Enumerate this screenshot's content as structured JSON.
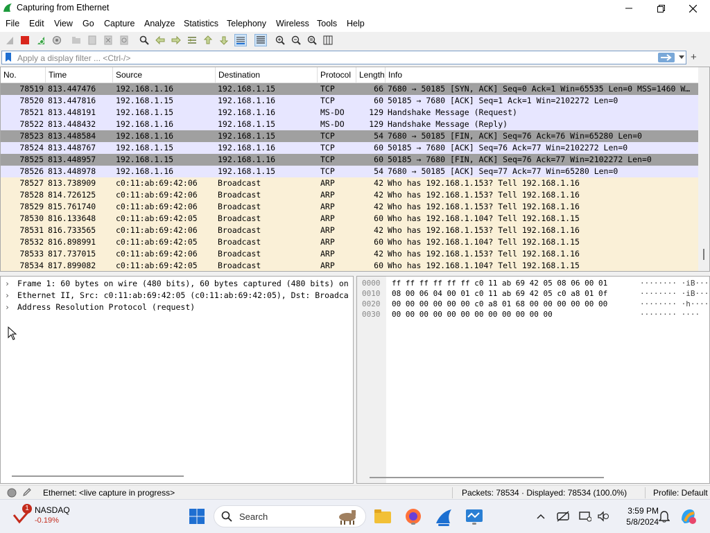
{
  "window": {
    "title": "Capturing from Ethernet"
  },
  "menu": [
    "File",
    "Edit",
    "View",
    "Go",
    "Capture",
    "Analyze",
    "Statistics",
    "Telephony",
    "Wireless",
    "Tools",
    "Help"
  ],
  "filter": {
    "placeholder": "Apply a display filter ... <Ctrl-/>",
    "value": ""
  },
  "packet_list": {
    "columns": [
      "No.",
      "Time",
      "Source",
      "Destination",
      "Protocol",
      "Length",
      "Info"
    ],
    "rows": [
      {
        "no": "78519",
        "time": "813.447476",
        "src": "192.168.1.16",
        "dst": "192.168.1.15",
        "proto": "TCP",
        "len": "66",
        "info": "7680 → 50185 [SYN, ACK] Seq=0 Ack=1 Win=65535 Len=0 MSS=1460 W…",
        "style": "dark"
      },
      {
        "no": "78520",
        "time": "813.447816",
        "src": "192.168.1.15",
        "dst": "192.168.1.16",
        "proto": "TCP",
        "len": "60",
        "info": "50185 → 7680 [ACK] Seq=1 Ack=1 Win=2102272 Len=0",
        "style": "tcp"
      },
      {
        "no": "78521",
        "time": "813.448191",
        "src": "192.168.1.15",
        "dst": "192.168.1.16",
        "proto": "MS-DO",
        "len": "129",
        "info": "Handshake Message (Request)",
        "style": "tcp"
      },
      {
        "no": "78522",
        "time": "813.448432",
        "src": "192.168.1.16",
        "dst": "192.168.1.15",
        "proto": "MS-DO",
        "len": "129",
        "info": "Handshake Message (Reply)",
        "style": "tcp"
      },
      {
        "no": "78523",
        "time": "813.448584",
        "src": "192.168.1.16",
        "dst": "192.168.1.15",
        "proto": "TCP",
        "len": "54",
        "info": "7680 → 50185 [FIN, ACK] Seq=76 Ack=76 Win=65280 Len=0",
        "style": "dark"
      },
      {
        "no": "78524",
        "time": "813.448767",
        "src": "192.168.1.15",
        "dst": "192.168.1.16",
        "proto": "TCP",
        "len": "60",
        "info": "50185 → 7680 [ACK] Seq=76 Ack=77 Win=2102272 Len=0",
        "style": "tcp"
      },
      {
        "no": "78525",
        "time": "813.448957",
        "src": "192.168.1.15",
        "dst": "192.168.1.16",
        "proto": "TCP",
        "len": "60",
        "info": "50185 → 7680 [FIN, ACK] Seq=76 Ack=77 Win=2102272 Len=0",
        "style": "dark"
      },
      {
        "no": "78526",
        "time": "813.448978",
        "src": "192.168.1.16",
        "dst": "192.168.1.15",
        "proto": "TCP",
        "len": "54",
        "info": "7680 → 50185 [ACK] Seq=77 Ack=77 Win=65280 Len=0",
        "style": "tcp"
      },
      {
        "no": "78527",
        "time": "813.738909",
        "src": "c0:11:ab:69:42:06",
        "dst": "Broadcast",
        "proto": "ARP",
        "len": "42",
        "info": "Who has 192.168.1.153? Tell 192.168.1.16",
        "style": "arp"
      },
      {
        "no": "78528",
        "time": "814.726125",
        "src": "c0:11:ab:69:42:06",
        "dst": "Broadcast",
        "proto": "ARP",
        "len": "42",
        "info": "Who has 192.168.1.153? Tell 192.168.1.16",
        "style": "arp"
      },
      {
        "no": "78529",
        "time": "815.761740",
        "src": "c0:11:ab:69:42:06",
        "dst": "Broadcast",
        "proto": "ARP",
        "len": "42",
        "info": "Who has 192.168.1.153? Tell 192.168.1.16",
        "style": "arp"
      },
      {
        "no": "78530",
        "time": "816.133648",
        "src": "c0:11:ab:69:42:05",
        "dst": "Broadcast",
        "proto": "ARP",
        "len": "60",
        "info": "Who has 192.168.1.104? Tell 192.168.1.15",
        "style": "arp"
      },
      {
        "no": "78531",
        "time": "816.733565",
        "src": "c0:11:ab:69:42:06",
        "dst": "Broadcast",
        "proto": "ARP",
        "len": "42",
        "info": "Who has 192.168.1.153? Tell 192.168.1.16",
        "style": "arp"
      },
      {
        "no": "78532",
        "time": "816.898991",
        "src": "c0:11:ab:69:42:05",
        "dst": "Broadcast",
        "proto": "ARP",
        "len": "60",
        "info": "Who has 192.168.1.104? Tell 192.168.1.15",
        "style": "arp"
      },
      {
        "no": "78533",
        "time": "817.737015",
        "src": "c0:11:ab:69:42:06",
        "dst": "Broadcast",
        "proto": "ARP",
        "len": "42",
        "info": "Who has 192.168.1.153? Tell 192.168.1.16",
        "style": "arp"
      },
      {
        "no": "78534",
        "time": "817.899082",
        "src": "c0:11:ab:69:42:05",
        "dst": "Broadcast",
        "proto": "ARP",
        "len": "60",
        "info": "Who has 192.168.1.104? Tell 192.168.1.15",
        "style": "arp"
      }
    ]
  },
  "details": [
    "Frame 1: 60 bytes on wire (480 bits), 60 bytes captured (480 bits) on",
    "Ethernet II, Src: c0:11:ab:69:42:05 (c0:11:ab:69:42:05), Dst: Broadca",
    "Address Resolution Protocol (request)"
  ],
  "bytes": [
    {
      "offset": "0000",
      "hex": "ff ff ff ff ff ff c0 11  ab 69 42 05 08 06 00 01",
      "ascii": "········ ·iB·····"
    },
    {
      "offset": "0010",
      "hex": "08 00 06 04 00 01 c0 11  ab 69 42 05 c0 a8 01 0f",
      "ascii": "········ ·iB·····"
    },
    {
      "offset": "0020",
      "hex": "00 00 00 00 00 00 c0 a8  01 68 00 00 00 00 00 00",
      "ascii": "········ ·h······"
    },
    {
      "offset": "0030",
      "hex": "00 00 00 00 00 00 00 00  00 00 00 00",
      "ascii": "········ ····"
    }
  ],
  "status": {
    "capture": "Ethernet: <live capture in progress>",
    "packets": "Packets: 78534 · Displayed: 78534 (100.0%)",
    "profile": "Profile: Default"
  },
  "taskbar": {
    "widget_name": "NASDAQ",
    "widget_change": "-0.19%",
    "widget_badge": "1",
    "search_label": "Search",
    "time": "3:59 PM",
    "date": "5/8/2024"
  },
  "colors": {
    "tcp_row": "#e7e6ff",
    "dark_row": "#a0a0a0",
    "arp_row": "#faf0d7",
    "accent": "#1f6fd1",
    "negative": "#c42b1c"
  }
}
